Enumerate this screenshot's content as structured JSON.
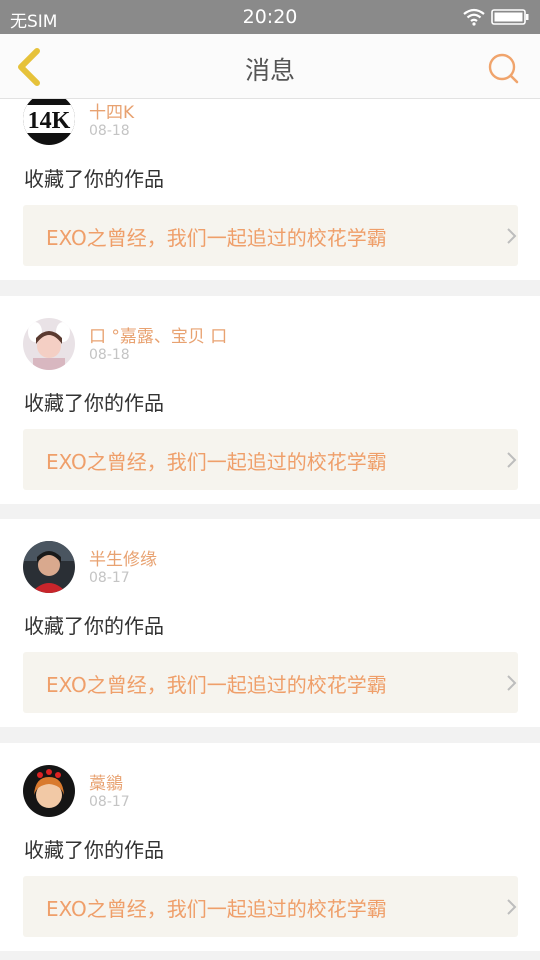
{
  "status_bar": {
    "carrier": "无SIM",
    "time": "20:20"
  },
  "header": {
    "title": "消息"
  },
  "colors": {
    "accent": "#e8a271",
    "back_icon": "#e6c23a",
    "link_bg": "#f6f4ee"
  },
  "messages": [
    {
      "username": "十四K",
      "date": "08-18",
      "action": "收藏了你的作品",
      "work_title": "EXO之曾经，我们一起追过的校花学霸",
      "avatar_text": "14K"
    },
    {
      "username": "口 °嘉露、宝贝 口",
      "date": "08-18",
      "action": "收藏了你的作品",
      "work_title": "EXO之曾经，我们一起追过的校花学霸"
    },
    {
      "username": "半生修缘",
      "date": "08-17",
      "action": "收藏了你的作品",
      "work_title": "EXO之曾经，我们一起追过的校花学霸"
    },
    {
      "username": "藁鶲",
      "date": "08-17",
      "action": "收藏了你的作品",
      "work_title": "EXO之曾经，我们一起追过的校花学霸"
    }
  ]
}
